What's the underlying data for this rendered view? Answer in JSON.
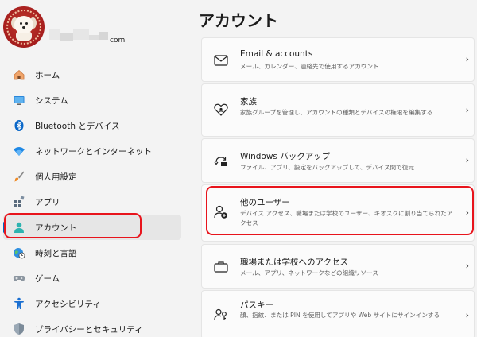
{
  "page": {
    "title": "アカウント"
  },
  "profile": {
    "email_suffix": "com"
  },
  "sidebar": {
    "items": [
      {
        "label": "ホーム",
        "icon": "home-icon"
      },
      {
        "label": "システム",
        "icon": "system-icon"
      },
      {
        "label": "Bluetooth とデバイス",
        "icon": "bluetooth-icon"
      },
      {
        "label": "ネットワークとインターネット",
        "icon": "wifi-icon"
      },
      {
        "label": "個人用設定",
        "icon": "brush-icon"
      },
      {
        "label": "アプリ",
        "icon": "apps-icon"
      },
      {
        "label": "アカウント",
        "icon": "account-icon",
        "active": true
      },
      {
        "label": "時刻と言語",
        "icon": "globe-clock-icon"
      },
      {
        "label": "ゲーム",
        "icon": "gamepad-icon"
      },
      {
        "label": "アクセシビリティ",
        "icon": "accessibility-icon"
      },
      {
        "label": "プライバシーとセキュリティ",
        "icon": "shield-icon"
      }
    ]
  },
  "cards": [
    {
      "title": "Email & accounts",
      "desc": "メール、カレンダー、連絡先で使用するアカウント",
      "icon": "mail-icon"
    },
    {
      "title": "家族",
      "desc": "家族グループを管理し、アカウントの種類とデバイスの権限を編集する",
      "icon": "family-heart-icon"
    },
    {
      "title": "Windows バックアップ",
      "desc": "ファイル、アプリ、設定をバックアップして、デバイス間で復元",
      "icon": "backup-icon"
    },
    {
      "title": "他のユーザー",
      "desc": "デバイス アクセス、職場または学校のユーザー、キオスクに割り当てられたアクセス",
      "icon": "add-user-icon"
    },
    {
      "title": "職場または学校へのアクセス",
      "desc": "メール、アプリ、ネットワークなどの組織リソース",
      "icon": "briefcase-icon"
    },
    {
      "title": "パスキー",
      "desc": "顔、指紋、または PIN を使用してアプリや Web サイトにサインインする",
      "icon": "passkey-icon"
    }
  ],
  "colors": {
    "accent": "#0067c0",
    "highlight": "#e8141c"
  }
}
